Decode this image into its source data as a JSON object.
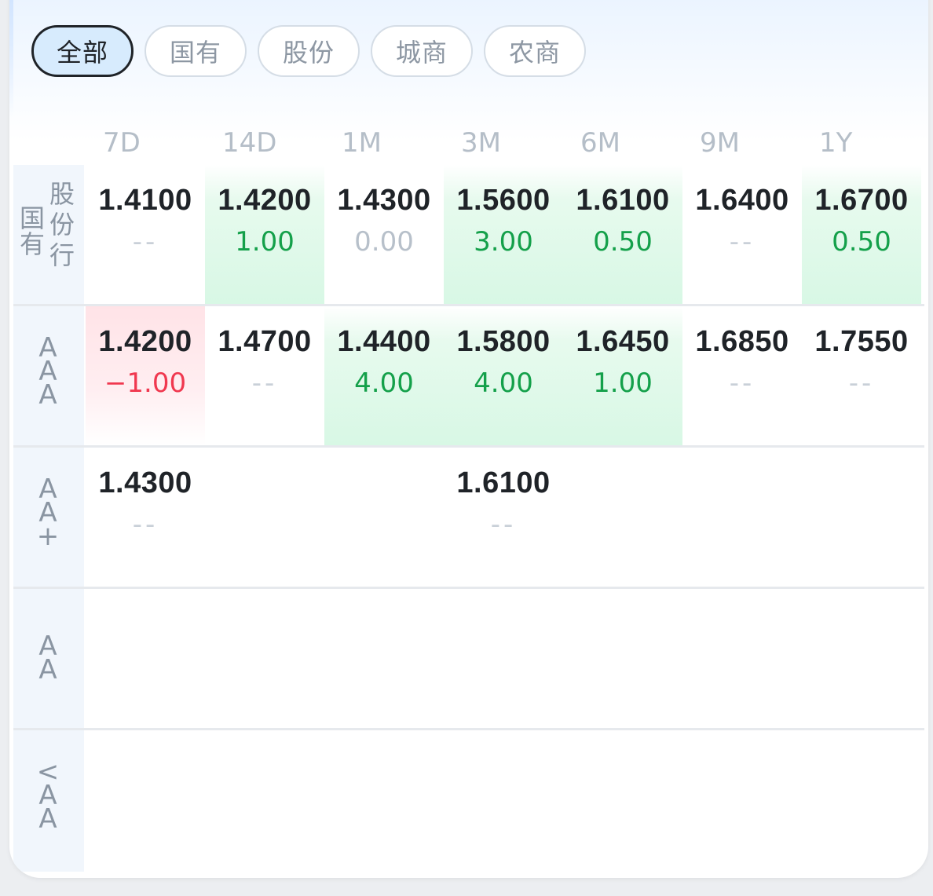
{
  "tabs": [
    {
      "label": "全部",
      "active": true
    },
    {
      "label": "国有",
      "active": false
    },
    {
      "label": "股份",
      "active": false
    },
    {
      "label": "城商",
      "active": false
    },
    {
      "label": "农商",
      "active": false
    }
  ],
  "columns": [
    "7D",
    "14D",
    "1M",
    "3M",
    "6M",
    "9M",
    "1Y"
  ],
  "rows": [
    {
      "label_left": [
        "国",
        "有"
      ],
      "label_right": [
        "股",
        "份",
        "行"
      ],
      "cells": [
        {
          "rate": "1.4100",
          "change": "--",
          "trend": "none"
        },
        {
          "rate": "1.4200",
          "change": "1.00",
          "trend": "up"
        },
        {
          "rate": "1.4300",
          "change": "0.00",
          "trend": "flat"
        },
        {
          "rate": "1.5600",
          "change": "3.00",
          "trend": "up"
        },
        {
          "rate": "1.6100",
          "change": "0.50",
          "trend": "up"
        },
        {
          "rate": "1.6400",
          "change": "--",
          "trend": "none"
        },
        {
          "rate": "1.6700",
          "change": "0.50",
          "trend": "up"
        }
      ]
    },
    {
      "label_chars": [
        "A",
        "A",
        "A"
      ],
      "cells": [
        {
          "rate": "1.4200",
          "change": "−1.00",
          "trend": "down"
        },
        {
          "rate": "1.4700",
          "change": "--",
          "trend": "none"
        },
        {
          "rate": "1.4400",
          "change": "4.00",
          "trend": "up"
        },
        {
          "rate": "1.5800",
          "change": "4.00",
          "trend": "up"
        },
        {
          "rate": "1.6450",
          "change": "1.00",
          "trend": "up"
        },
        {
          "rate": "1.6850",
          "change": "--",
          "trend": "none"
        },
        {
          "rate": "1.7550",
          "change": "--",
          "trend": "none"
        }
      ]
    },
    {
      "label_chars": [
        "A",
        "A",
        "+"
      ],
      "cells": [
        {
          "rate": "1.4300",
          "change": "--",
          "trend": "none"
        },
        null,
        null,
        {
          "rate": "1.6100",
          "change": "--",
          "trend": "none"
        },
        null,
        null,
        null
      ]
    },
    {
      "label_chars": [
        "A",
        "A"
      ],
      "cells": [
        null,
        null,
        null,
        null,
        null,
        null,
        null
      ]
    },
    {
      "label_chars": [
        "<",
        "A",
        "A"
      ],
      "cells": [
        null,
        null,
        null,
        null,
        null,
        null,
        null
      ]
    }
  ],
  "colors": {
    "up": "#14a04a",
    "down": "#f0384f",
    "active_tab_bg": "#d7ebfd",
    "label_col_bg": "#f1f6fc"
  }
}
